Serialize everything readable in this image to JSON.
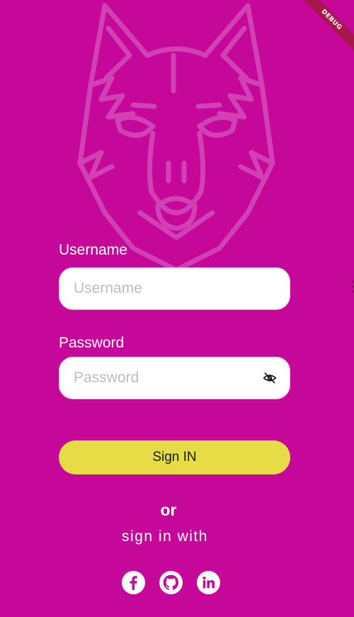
{
  "banner": {
    "label": "DEBUG"
  },
  "username": {
    "label": "Username",
    "placeholder": "Username",
    "value": ""
  },
  "password": {
    "label": "Password",
    "placeholder": "Password",
    "value": "",
    "toggle_icon": "eye-off-icon"
  },
  "actions": {
    "sign_in_label": "Sign IN"
  },
  "divider": {
    "or": "or",
    "sign_in_with": "sign in with"
  },
  "social": [
    {
      "name": "facebook-icon"
    },
    {
      "name": "github-icon"
    },
    {
      "name": "linkedin-icon"
    }
  ],
  "colors": {
    "background": "#c6089a",
    "button": "#e6dc46",
    "wolf_outline": "#d54aba",
    "field": "#ffffff"
  }
}
